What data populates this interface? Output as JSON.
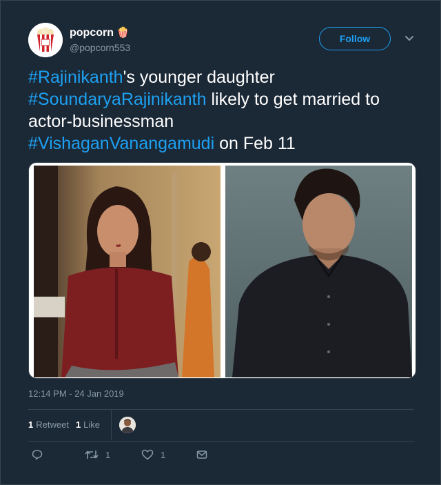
{
  "author": {
    "name": "popcorn",
    "emoji": "🍿",
    "handle": "@popcorn553"
  },
  "follow_label": "Follow",
  "tweet": {
    "tag1": "#Rajinikanth",
    "text1": "'s younger daughter",
    "tag2": "#SoundaryaRajinikanth",
    "text2": " likely to get married to actor-businessman",
    "tag3": "#VishaganVanangamudi",
    "text3": " on Feb 11"
  },
  "timestamp": "12:14 PM - 24 Jan 2019",
  "stats": {
    "retweet_count": "1",
    "retweet_label": "Retweet",
    "like_count": "1",
    "like_label": "Like"
  },
  "actions": {
    "retweets": "1",
    "likes": "1"
  },
  "icons": [
    "popcorn-avatar-icon",
    "chevron-down-icon",
    "reply-icon",
    "retweet-icon",
    "heart-icon",
    "message-icon"
  ],
  "colors": {
    "accent": "#1da1f2",
    "background": "#1b2836",
    "muted": "#8899a6"
  }
}
